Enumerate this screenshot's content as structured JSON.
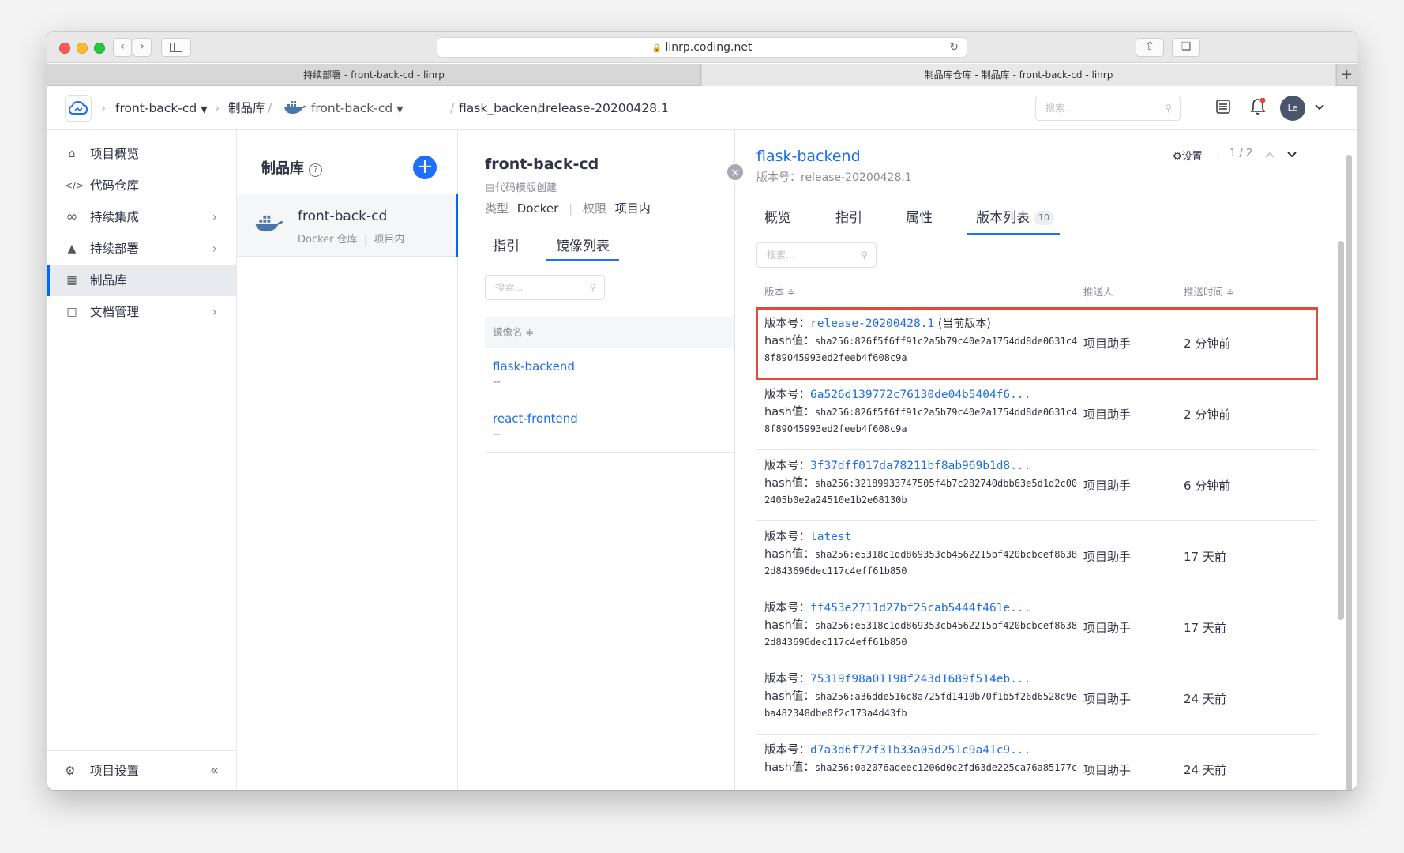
{
  "browser": {
    "url": "linrp.coding.net",
    "tabs": [
      "持续部署 - front-back-cd - linrp",
      "制品库仓库 - 制品库 - front-back-cd - linrp"
    ]
  },
  "topbar": {
    "project": "front-back-cd",
    "crumb_artifacts": "制品库",
    "repo": "front-back-cd",
    "image": "flask_backend",
    "version": "release-20200428.1",
    "search_placeholder": "搜索...",
    "avatar": "Le",
    "accent_color": "#1f6fff",
    "notification_dot_color": "#e5483b"
  },
  "sidebar": {
    "items": [
      {
        "label": "项目概览",
        "icon": "home-icon"
      },
      {
        "label": "代码仓库",
        "icon": "code-icon"
      },
      {
        "label": "持续集成",
        "icon": "infinity-icon",
        "has_children": true
      },
      {
        "label": "持续部署",
        "icon": "rocket-icon",
        "has_children": true
      },
      {
        "label": "制品库",
        "icon": "artifact-icon",
        "active": true
      },
      {
        "label": "文档管理",
        "icon": "document-icon",
        "has_children": true
      }
    ],
    "footer": "项目设置"
  },
  "repos": {
    "title": "制品库",
    "items": [
      {
        "name": "front-back-cd",
        "type": "Docker 仓库",
        "scope": "项目内"
      }
    ]
  },
  "repo_detail": {
    "name": "front-back-cd",
    "desc": "由代码模版创建",
    "type_label": "类型",
    "type_value": "Docker",
    "perm_label": "权限",
    "perm_value": "项目内",
    "tabs": [
      "指引",
      "镜像列表"
    ],
    "search_placeholder": "搜索...",
    "col_header": "镜像名 ≑",
    "images": [
      {
        "name": "flask-backend",
        "desc": "--"
      },
      {
        "name": "react-frontend",
        "desc": "--"
      }
    ]
  },
  "panel": {
    "title": "flask-backend",
    "subtitle": "版本号：release-20200428.1",
    "settings": "设置",
    "pager": "1 / 2",
    "tabs": [
      "概览",
      "指引",
      "属性",
      "版本列表"
    ],
    "tab_count": "10",
    "search_placeholder": "搜索...",
    "headers": {
      "version": "版本 ≑",
      "pusher": "推送人",
      "time": "推送时间 ≑"
    },
    "version_label": "版本号：",
    "hash_label": "hash值：",
    "current_tag": "(当前版本)",
    "rows": [
      {
        "version": "release-20200428.1",
        "hash1": "sha256:826f5f6ff91c2a5b79c40e2a1754dd8de0631c4",
        "hash2": "8f89045993ed2feeb4f608c9a",
        "pusher": "项目助手",
        "time": "2 分钟前",
        "current": true
      },
      {
        "version": "6a526d139772c76130de04b5404f6...",
        "hash1": "sha256:826f5f6ff91c2a5b79c40e2a1754dd8de0631c4",
        "hash2": "8f89045993ed2feeb4f608c9a",
        "pusher": "项目助手",
        "time": "2 分钟前"
      },
      {
        "version": "3f37dff017da78211bf8ab969b1d8...",
        "hash1": "sha256:32189933747505f4b7c282740dbb63e5d1d2c00",
        "hash2": "2405b0e2a24510e1b2e68130b",
        "pusher": "项目助手",
        "time": "6 分钟前"
      },
      {
        "version": "latest",
        "hash1": "sha256:e5318c1dd869353cb4562215bf420bcbcef8638",
        "hash2": "2d843696dec117c4eff61b850",
        "pusher": "项目助手",
        "time": "17 天前"
      },
      {
        "version": "ff453e2711d27bf25cab5444f461e...",
        "hash1": "sha256:e5318c1dd869353cb4562215bf420bcbcef8638",
        "hash2": "2d843696dec117c4eff61b850",
        "pusher": "项目助手",
        "time": "17 天前"
      },
      {
        "version": "75319f98a01198f243d1689f514eb...",
        "hash1": "sha256:a36dde516c8a725fd1410b70f1b5f26d6528c9e",
        "hash2": "ba482348dbe0f2c173a4d43fb",
        "pusher": "项目助手",
        "time": "24 天前"
      },
      {
        "version": "d7a3d6f72f31b33a05d251c9a41c9...",
        "hash1": "sha256:0a2076adeec1206d0c2fd63de225ca76a85177c",
        "hash2": "",
        "pusher": "项目助手",
        "time": "24 天前"
      }
    ]
  }
}
